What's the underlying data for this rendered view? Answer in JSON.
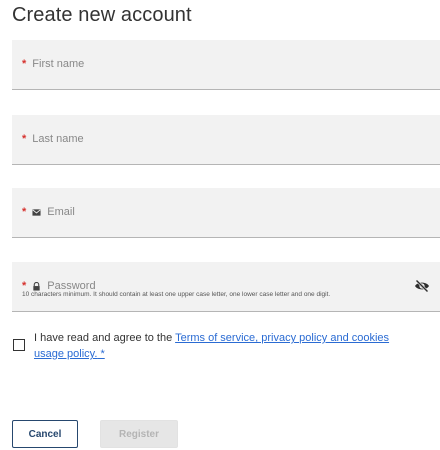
{
  "page_title": "Create new account",
  "fields": {
    "first_name": {
      "label": "First name",
      "required_mark": "*"
    },
    "last_name": {
      "label": "Last name",
      "required_mark": "*"
    },
    "email": {
      "label": "Email",
      "required_mark": "*",
      "icon": "envelope-icon"
    },
    "password": {
      "label": "Password",
      "required_mark": "*",
      "icon": "lock-icon",
      "toggle_icon": "eye-slash-icon"
    }
  },
  "password_hint": "10 characters minimum. It should contain at least one upper case letter, one lower case letter and one digit.",
  "consent": {
    "checked": false,
    "prefix": "I have read and agree to the ",
    "link_text": "Terms of service, privacy policy and cookies usage policy.",
    "suffix": " *"
  },
  "buttons": {
    "cancel": "Cancel",
    "register": "Register"
  },
  "colors": {
    "required": "#d6322e",
    "link": "#2a6bd3",
    "primary_outline": "#26476e",
    "field_bg": "#f2f2f2",
    "disabled_bg": "#e6e6e6"
  }
}
